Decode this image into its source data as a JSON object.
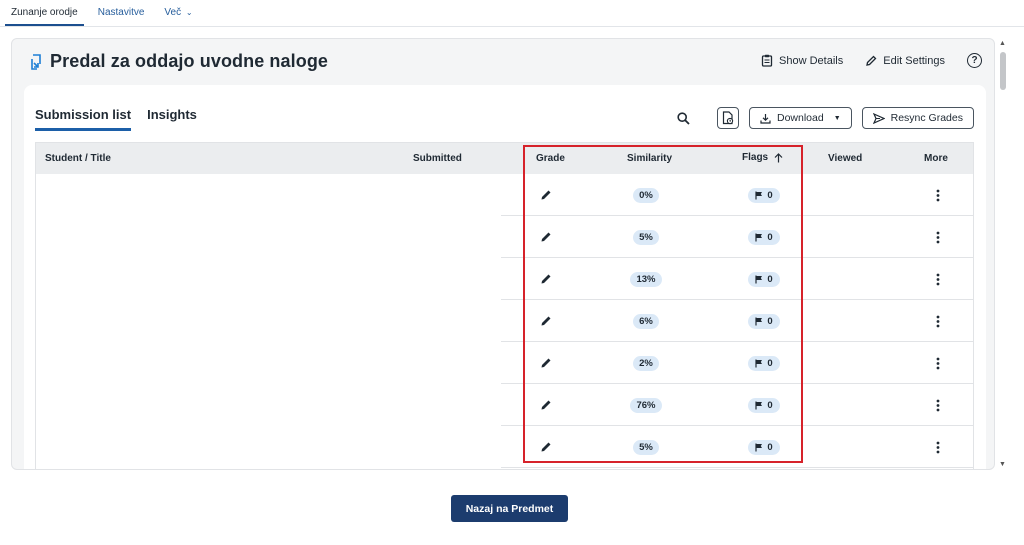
{
  "topnav": {
    "tabs": [
      {
        "label": "Zunanje orodje",
        "active": true
      },
      {
        "label": "Nastavitve",
        "active": false
      },
      {
        "label": "Več",
        "active": false
      }
    ]
  },
  "header": {
    "title": "Predal za oddajo uvodne naloge",
    "show_details": "Show Details",
    "edit_settings": "Edit Settings",
    "help": "?"
  },
  "tabs": [
    {
      "label": "Submission list",
      "active": true
    },
    {
      "label": "Insights",
      "active": false
    }
  ],
  "toolbar": {
    "download_label": "Download",
    "resync_label": "Resync Grades"
  },
  "table": {
    "columns": {
      "student": "Student / Title",
      "submitted": "Submitted",
      "grade": "Grade",
      "similarity": "Similarity",
      "flags": "Flags",
      "viewed": "Viewed",
      "more": "More"
    },
    "rows": [
      {
        "similarity": "0%",
        "flags": "0"
      },
      {
        "similarity": "5%",
        "flags": "0"
      },
      {
        "similarity": "13%",
        "flags": "0"
      },
      {
        "similarity": "6%",
        "flags": "0"
      },
      {
        "similarity": "2%",
        "flags": "0"
      },
      {
        "similarity": "76%",
        "flags": "0"
      },
      {
        "similarity": "5%",
        "flags": "0"
      }
    ]
  },
  "footer": {
    "back_label": "Nazaj na Predmet"
  },
  "colors": {
    "accent": "#1c5fa8",
    "pill": "#dbe9f7",
    "highlight": "#d6222a",
    "primary_button": "#1c3c6e"
  }
}
